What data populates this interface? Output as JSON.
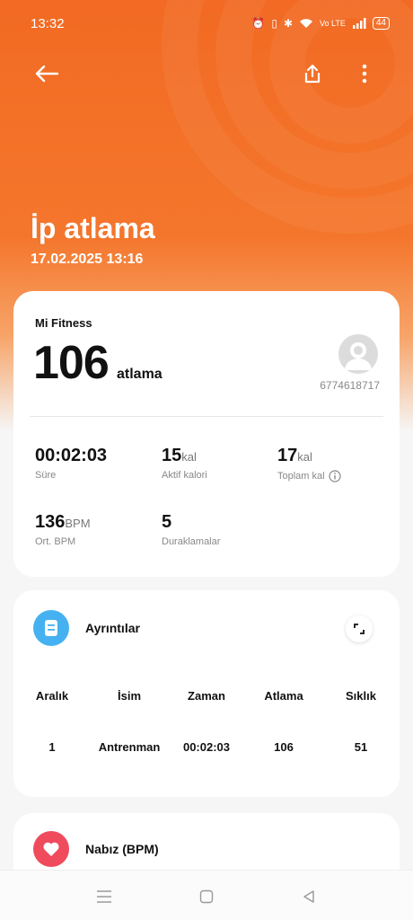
{
  "status_bar": {
    "time": "13:32",
    "battery": "44"
  },
  "header": {
    "title": "İp atlama",
    "date": "17.02.2025 13:16"
  },
  "summary": {
    "source": "Mi Fitness",
    "count": "106",
    "count_unit": "atlama",
    "user_id": "6774618717",
    "stats": [
      {
        "value": "00:02:03",
        "unit": "",
        "label": "Süre"
      },
      {
        "value": "15",
        "unit": "kal",
        "label": "Aktif kalori"
      },
      {
        "value": "17",
        "unit": "kal",
        "label": "Toplam kal"
      },
      {
        "value": "136",
        "unit": "BPM",
        "label": "Ort. BPM"
      },
      {
        "value": "5",
        "unit": "",
        "label": "Duraklamalar"
      }
    ]
  },
  "details": {
    "title": "Ayrıntılar",
    "columns": [
      "Aralık",
      "İsim",
      "Zaman",
      "Atlama",
      "Sıklık"
    ],
    "rows": [
      [
        "1",
        "Antrenman",
        "00:02:03",
        "106",
        "51"
      ]
    ]
  },
  "pulse": {
    "title": "Nabız (BPM)"
  },
  "icons": {
    "back": "arrow-left-icon",
    "share": "share-icon",
    "more": "more-vertical-icon",
    "details": "document-icon",
    "expand": "expand-icon",
    "pulse": "heart-icon",
    "info": "info-icon"
  },
  "colors": {
    "accent": "#f26a23",
    "details_icon": "#46b1f0",
    "pulse_icon": "#ef4b5d"
  }
}
